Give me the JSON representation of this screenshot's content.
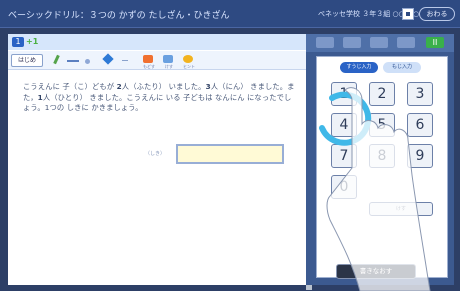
{
  "header": {
    "title": "ベーシックドリル：３つの かずの たしざん・ひきざん",
    "status": "ぺネッセ学校 ３年３組 ○○ ○○",
    "end_label": "おわる"
  },
  "question": {
    "number": "1",
    "tag": "+1",
    "text_html": "こうえんに 子（こ）どもが <b>2</b>人（ふたり） いました。<b>3</b>人（にん） きました。また，<b>1</b>人（ひとり） きました。こうえんに いる 子どもは なんにん になったでしょう。1つの しきに かきましょう。",
    "answer_label": "（しき）"
  },
  "toolbar": {
    "first_label": "はじめ",
    "c1_label": "もどす",
    "c2_label": "けす",
    "c3_label": "ヒント"
  },
  "keypad": {
    "tab_active": "すうじ入力",
    "tab_other": "もじ入力",
    "keys": [
      "1",
      "2",
      "3",
      "4",
      "5",
      "6",
      "7",
      "8",
      "9",
      "0"
    ],
    "clear_label": "けす",
    "rewrite_label": "書きなおす",
    "mode_symbol": "II"
  },
  "colors": {
    "frame": "#2d3f66",
    "accent_blue": "#2a63c6",
    "green": "#39b04a",
    "answer_box": "#fffad6",
    "swipe_cyan": "#3fb8e8"
  }
}
